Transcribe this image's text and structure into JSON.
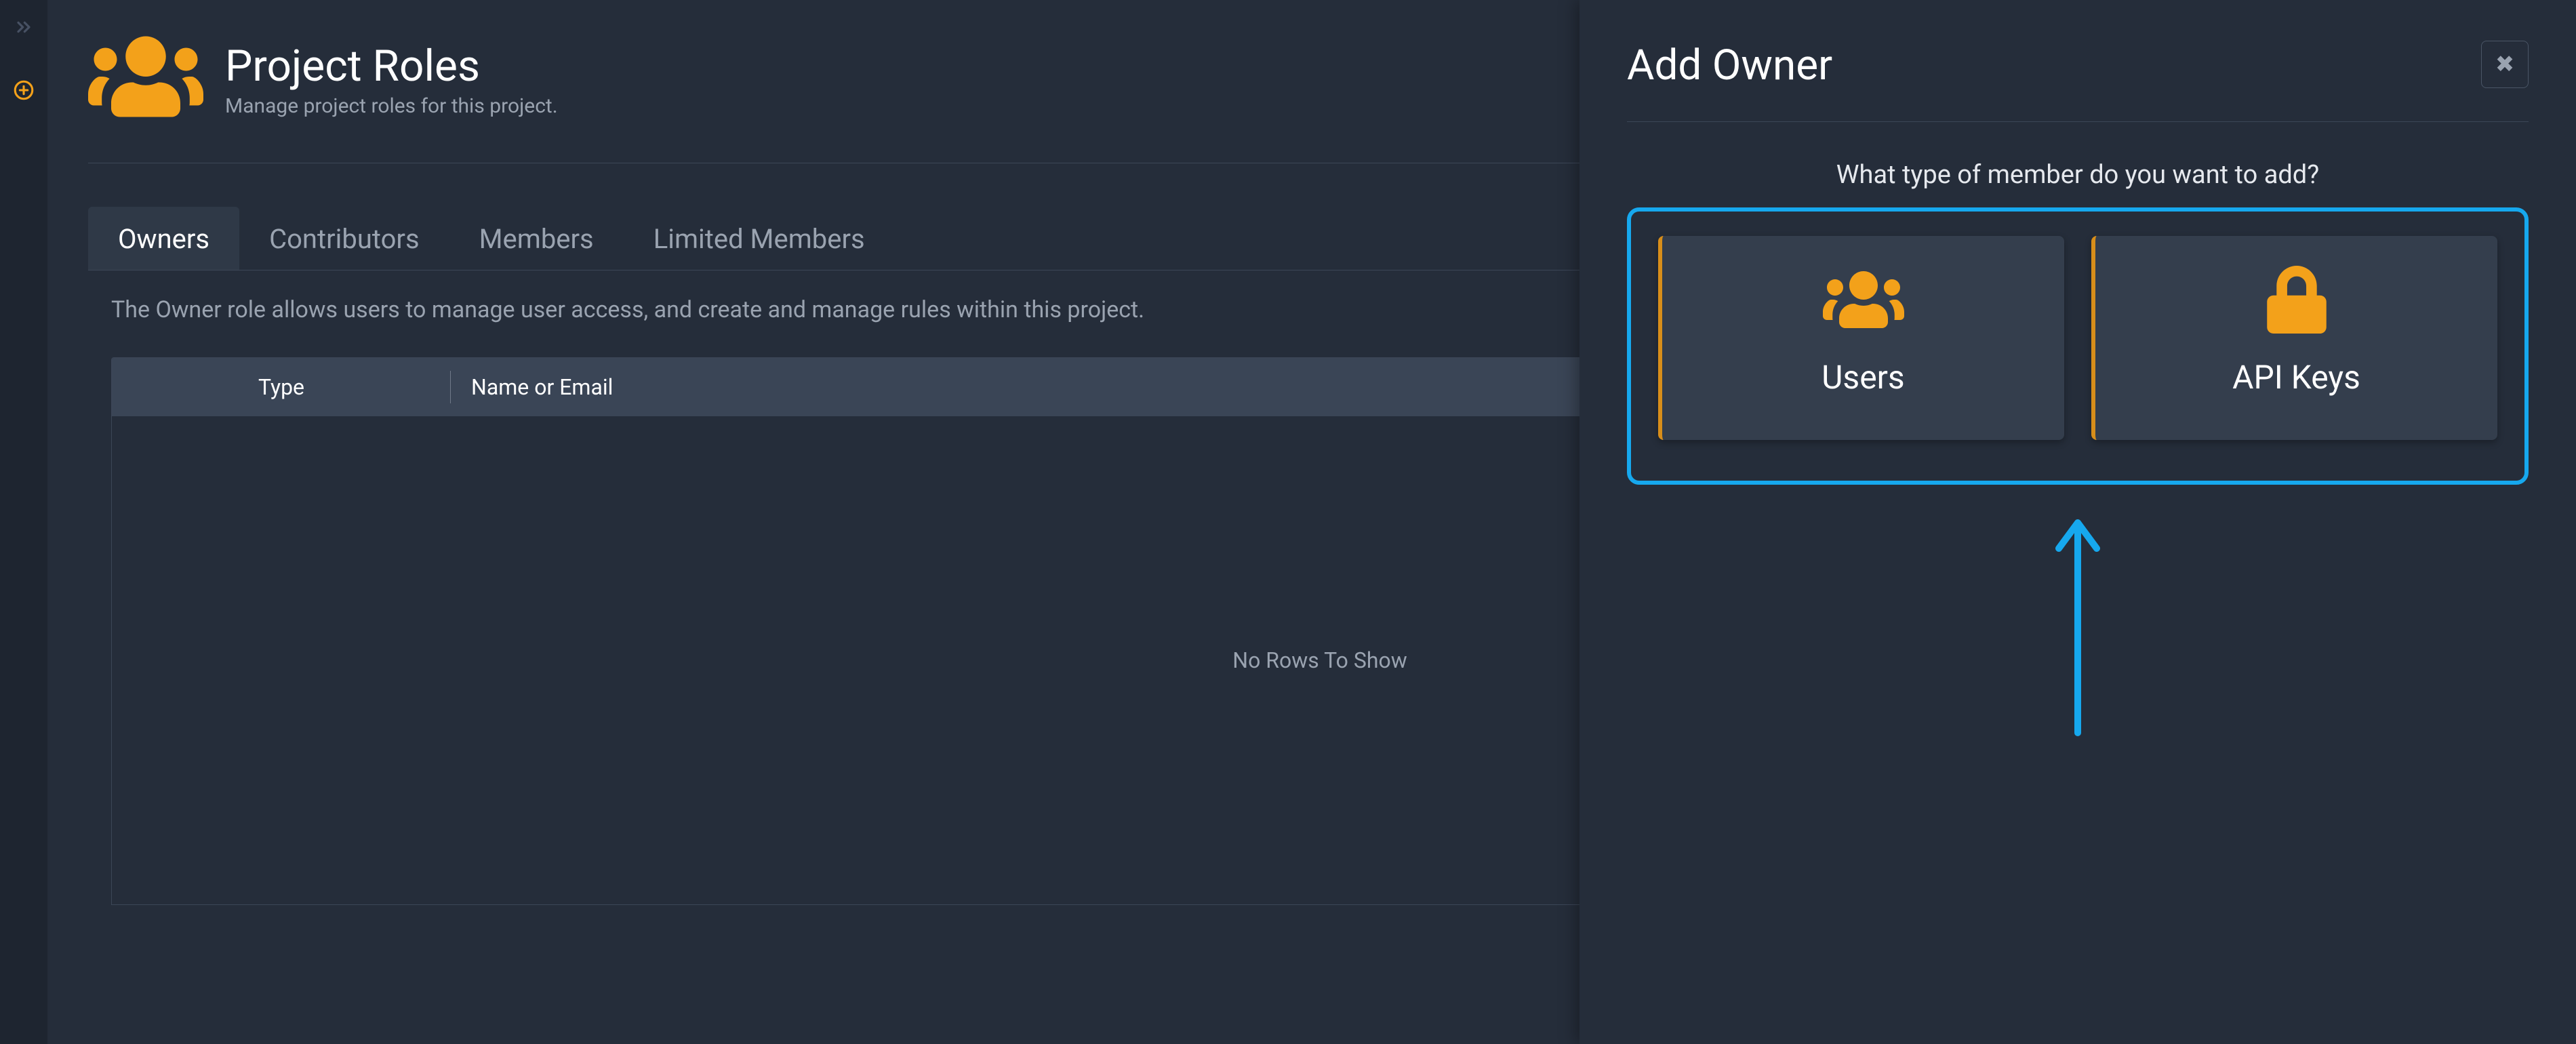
{
  "header": {
    "title": "Project Roles",
    "subtitle": "Manage project roles for this project."
  },
  "tabs": [
    {
      "label": "Owners",
      "active": true
    },
    {
      "label": "Contributors",
      "active": false
    },
    {
      "label": "Members",
      "active": false
    },
    {
      "label": "Limited Members",
      "active": false
    }
  ],
  "role_description": "The Owner role allows users to manage user access, and create and manage rules within this project.",
  "table": {
    "columns": {
      "type": "Type",
      "name": "Name or Email"
    },
    "empty_text": "No Rows To Show",
    "rows": []
  },
  "panel": {
    "title": "Add Owner",
    "prompt": "What type of member do you want to add?",
    "options": [
      {
        "id": "users",
        "label": "Users",
        "icon": "users-icon"
      },
      {
        "id": "api-keys",
        "label": "API Keys",
        "icon": "lock-icon"
      }
    ]
  },
  "colors": {
    "accent": "#f3a11a",
    "callout_border": "#16a8ee"
  }
}
